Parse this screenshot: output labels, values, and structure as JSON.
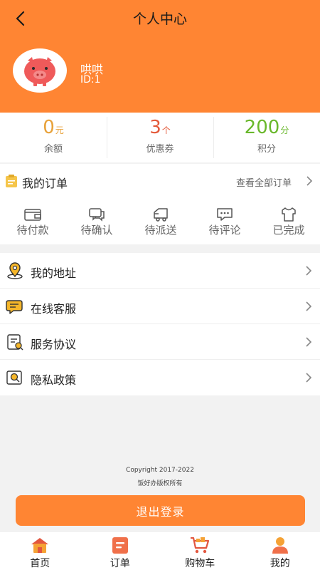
{
  "colors": {
    "brand": "#ff8533",
    "balance": "#e8a23a",
    "coupon": "#e45a3b",
    "points": "#6ab82c"
  },
  "header": {
    "title": "个人中心",
    "back_icon": "back-arrow-icon"
  },
  "user": {
    "name": "哄哄",
    "id": "ID:1",
    "avatar_icon": "pig-avatar-icon"
  },
  "stats": [
    {
      "value": "0",
      "unit": "元",
      "label": "余额"
    },
    {
      "value": "3",
      "unit": "个",
      "label": "优惠券"
    },
    {
      "value": "200",
      "unit": "分",
      "label": "积分"
    }
  ],
  "orders": {
    "title": "我的订单",
    "view_all": "查看全部订单",
    "statuses": [
      {
        "label": "待付款",
        "icon": "wallet-icon"
      },
      {
        "label": "待确认",
        "icon": "chat-bubbles-icon"
      },
      {
        "label": "待派送",
        "icon": "delivery-truck-icon"
      },
      {
        "label": "待评论",
        "icon": "comment-icon"
      },
      {
        "label": "已完成",
        "icon": "shirt-icon"
      }
    ]
  },
  "menu": [
    {
      "label": "我的地址",
      "icon": "location-pin-icon"
    },
    {
      "label": "在线客服",
      "icon": "customer-service-icon"
    },
    {
      "label": "服务协议",
      "icon": "agreement-document-icon"
    },
    {
      "label": "隐私政策",
      "icon": "privacy-icon"
    }
  ],
  "footer": {
    "copyright_line1": "Copyright 2017-2022",
    "copyright_line2": "饭好办版权所有",
    "logout": "退出登录"
  },
  "tabs": [
    {
      "label": "首页",
      "icon": "home-icon"
    },
    {
      "label": "订单",
      "icon": "order-list-icon"
    },
    {
      "label": "购物车",
      "icon": "cart-icon"
    },
    {
      "label": "我的",
      "icon": "profile-icon"
    }
  ]
}
